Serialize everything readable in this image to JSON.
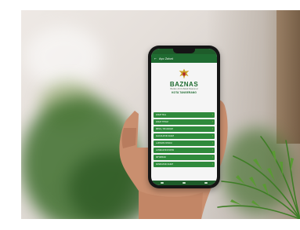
{
  "app": {
    "title": "Ayo Zakat",
    "org_name": "BAZNAS",
    "org_sub": "Badan Amil Zakat Nasional",
    "org_city": "KOTA TANGERANG"
  },
  "menu": [
    {
      "label": "ZAKAT MAL"
    },
    {
      "label": "ZAKAT FITRAH"
    },
    {
      "label": "INFAQ / SHADAQAH"
    },
    {
      "label": "KALKULATOR ZAKAT"
    },
    {
      "label": "LAPORAN DONASI"
    },
    {
      "label": "LAYANAN MUSTAHIK"
    },
    {
      "label": "INFORMASI"
    },
    {
      "label": "KONSULTASI ZAKAT"
    }
  ],
  "colors": {
    "brand_green": "#1f6b31",
    "menu_green": "#2f8a3c",
    "accent_yellow": "#f0d14a"
  }
}
